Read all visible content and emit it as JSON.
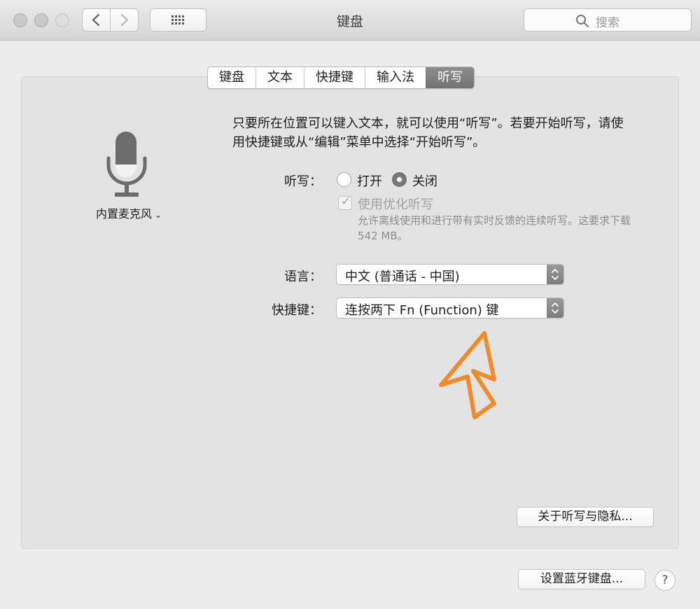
{
  "window": {
    "title": "键盘",
    "search_placeholder": "搜索"
  },
  "tabs": [
    {
      "label": "键盘",
      "selected": false
    },
    {
      "label": "文本",
      "selected": false
    },
    {
      "label": "快捷键",
      "selected": false
    },
    {
      "label": "输入法",
      "selected": false
    },
    {
      "label": "听写",
      "selected": true
    }
  ],
  "microphone": {
    "source_label": "内置麦克风"
  },
  "dictation": {
    "description": "只要所在位置可以键入文本，就可以使用“听写”。若要开始听写，请使用快捷键或从“编辑”菜单中选择“开始听写”。",
    "label": "听写：",
    "option_on": "打开",
    "option_off": "关闭",
    "selected": "关闭",
    "enhanced_label": "使用优化听写",
    "enhanced_checked": true,
    "enhanced_note": "允许离线使用和进行带有实时反馈的连续听写。这要求下载 542 MB。"
  },
  "language": {
    "label": "语言：",
    "value": "中文 (普通话 - 中国)"
  },
  "shortcut": {
    "label": "快捷键：",
    "value": "连按两下 Fn (Function) 键"
  },
  "buttons": {
    "privacy": "关于听写与隐私...",
    "bluetooth": "设置蓝牙键盘...",
    "help": "?"
  },
  "colors": {
    "annotation_arrow": "#f08b2c",
    "selected_tab": "#7b7b7b"
  }
}
